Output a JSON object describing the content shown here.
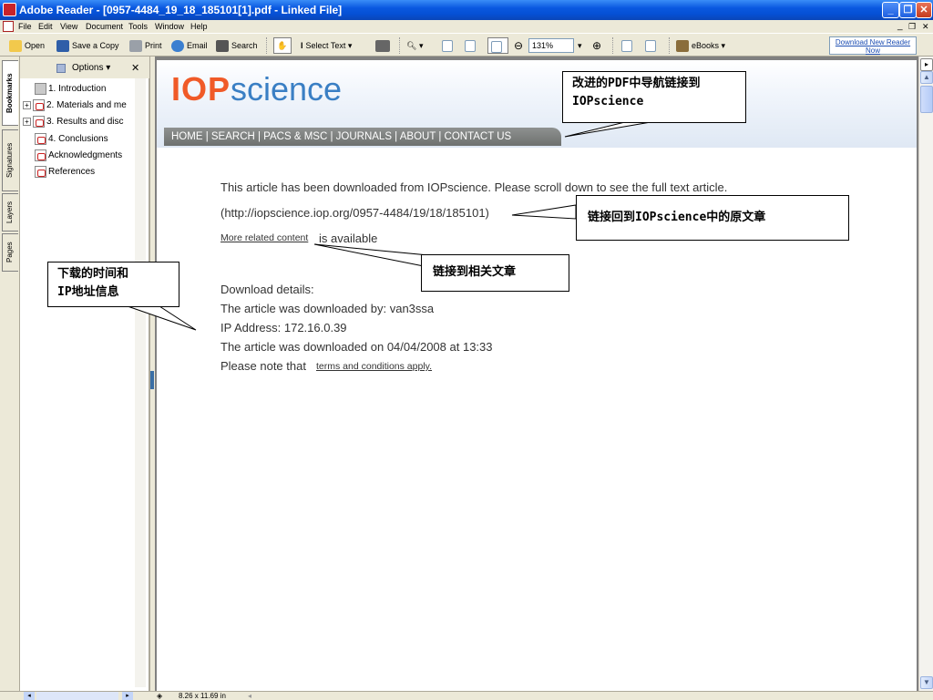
{
  "window": {
    "title": "Adobe Reader - [0957-4484_19_18_185101[1].pdf - Linked File]"
  },
  "menu": {
    "items": [
      "File",
      "Edit",
      "View",
      "Document",
      "Tools",
      "Window",
      "Help"
    ]
  },
  "toolbar": {
    "open": "Open",
    "save_copy": "Save a Copy",
    "print": "Print",
    "email": "Email",
    "search": "Search",
    "select_text": "Select Text",
    "zoom": "131%",
    "ebooks": "eBooks",
    "download_reader": "Download New Reader Now"
  },
  "side_tabs": [
    "Bookmarks",
    "Signatures",
    "Layers",
    "Pages"
  ],
  "bookmarks": {
    "options": "Options",
    "items": [
      "1. Introduction",
      "2. Materials and me",
      "3. Results and disc",
      "4. Conclusions",
      "Acknowledgments",
      "References"
    ]
  },
  "iop": {
    "logo_iop": "IOP",
    "logo_science": "science",
    "nav": "HOME  |  SEARCH  |  PACS & MSC  |  JOURNALS  |  ABOUT  |  CONTACT US"
  },
  "article": {
    "line1": "This article has been downloaded from IOPscience. Please scroll down to see the full text article.",
    "url": "(http://iopscience.iop.org/0957-4484/19/18/185101)",
    "related_link": "More related content",
    "related_suffix": "is available",
    "dl_header": "Download details:",
    "dl_by": "The article was downloaded by: van3ssa",
    "dl_ip": "IP Address: 172.16.0.39",
    "dl_on": "The article was downloaded on 04/04/2008 at 13:33",
    "note_prefix": "Please note that",
    "terms_link": "terms and conditions apply."
  },
  "callouts": {
    "nav_l1": "改进的PDF中导航链接到",
    "nav_l2": "IOPscience",
    "original": "链接回到IOPscience中的原文章",
    "related": "链接到相关文章",
    "dl_l1": "下载的时间和",
    "dl_l2": "IP地址信息"
  },
  "status": {
    "page_size": "8.26 x 11.69 in"
  }
}
